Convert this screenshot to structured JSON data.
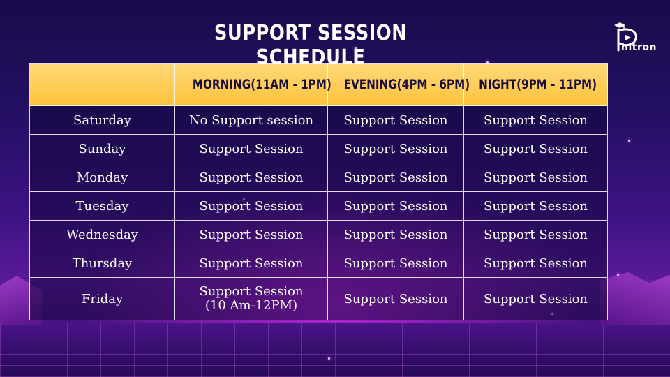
{
  "title": "SUPPORT SESSION SCHEDULE",
  "logo": {
    "text": "hitron",
    "icon": "phitron-logo-icon"
  },
  "table": {
    "headers": [
      "",
      "MORNING(11AM - 1PM)",
      "EVENING(4PM - 6PM)",
      "NIGHT(9PM - 11PM)"
    ],
    "rows": [
      {
        "day": "Saturday",
        "morning": "No Support session",
        "evening": "Support Session",
        "night": "Support Session"
      },
      {
        "day": "Sunday",
        "morning": "Support Session",
        "evening": "Support Session",
        "night": "Support Session"
      },
      {
        "day": "Monday",
        "morning": "Support Session",
        "evening": "Support Session",
        "night": "Support Session"
      },
      {
        "day": "Tuesday",
        "morning": "Support Session",
        "evening": "Support Session",
        "night": "Support Session"
      },
      {
        "day": "Wednesday",
        "morning": "Support Session",
        "evening": "Support Session",
        "night": "Support Session"
      },
      {
        "day": "Thursday",
        "morning": "Support Session",
        "evening": "Support Session",
        "night": "Support Session"
      },
      {
        "day": "Friday",
        "morning": "Support Session",
        "morning_note": "(10 Am-12PM)",
        "evening": "Support Session",
        "night": "Support Session"
      }
    ]
  },
  "colors": {
    "header_bg": "#ffc23a",
    "header_text": "#1b0d3a",
    "background": "#241064",
    "text": "#ffffff"
  }
}
